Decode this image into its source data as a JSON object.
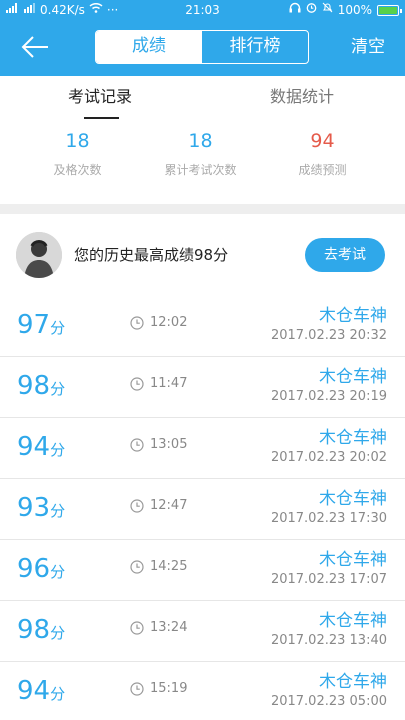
{
  "status_bar": {
    "net_speed": "0.42K/s",
    "dots": "···",
    "time": "21:03",
    "battery_percent": "100%",
    "battery_level": 1.0
  },
  "header": {
    "back_icon": "arrow-left-icon",
    "tabs": [
      {
        "label": "成绩"
      },
      {
        "label": "排行榜"
      }
    ],
    "clear_label": "清空"
  },
  "subtabs": [
    {
      "label": "考试记录"
    },
    {
      "label": "数据统计"
    }
  ],
  "stats": [
    {
      "value": "18",
      "label": "及格次数"
    },
    {
      "value": "18",
      "label": "累计考试次数"
    },
    {
      "value": "94",
      "label": "成绩预测"
    }
  ],
  "best": {
    "text": "您的历史最高成绩98分",
    "button_label": "去考试"
  },
  "records": [
    {
      "score": "97",
      "unit": "分",
      "duration": "12:02",
      "name": "木仓车神",
      "date": "2017.02.23   20:32"
    },
    {
      "score": "98",
      "unit": "分",
      "duration": "11:47",
      "name": "木仓车神",
      "date": "2017.02.23   20:19"
    },
    {
      "score": "94",
      "unit": "分",
      "duration": "13:05",
      "name": "木仓车神",
      "date": "2017.02.23   20:02"
    },
    {
      "score": "93",
      "unit": "分",
      "duration": "12:47",
      "name": "木仓车神",
      "date": "2017.02.23   17:30"
    },
    {
      "score": "96",
      "unit": "分",
      "duration": "14:25",
      "name": "木仓车神",
      "date": "2017.02.23   17:07"
    },
    {
      "score": "98",
      "unit": "分",
      "duration": "13:24",
      "name": "木仓车神",
      "date": "2017.02.23   13:40"
    },
    {
      "score": "94",
      "unit": "分",
      "duration": "15:19",
      "name": "木仓车神",
      "date": "2017.02.23   05:00"
    }
  ],
  "colors": {
    "primary": "#2fa8ea",
    "prediction": "#e55a4a",
    "battery_fill": "#58d14a"
  }
}
